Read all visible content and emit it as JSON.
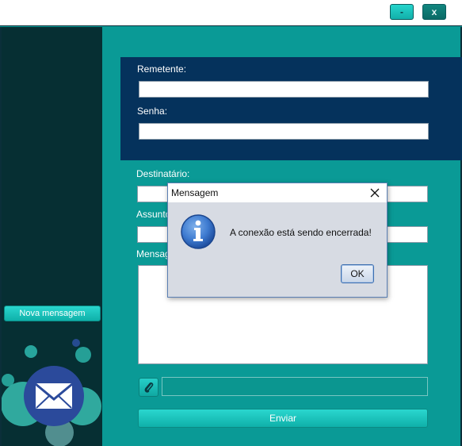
{
  "window": {
    "minimize_label": "-",
    "close_label": "x"
  },
  "sidebar": {
    "new_message_label": "Nova mensagem",
    "logo_icon": "envelope-icon"
  },
  "form": {
    "sender_label": "Remetente:",
    "sender_value": "",
    "password_label": "Senha:",
    "password_value": "",
    "recipient_label": "Destinatário:",
    "recipient_value": "",
    "subject_label": "Assunto:",
    "subject_value": "",
    "message_label": "Mensagem:",
    "message_value": "",
    "attachment_icon": "paperclip-icon",
    "attachment_value": "",
    "send_label": "Enviar"
  },
  "dialog": {
    "title": "Mensagem",
    "close_label": "close",
    "icon": "info-icon",
    "message": "A conexão está sendo encerrada!",
    "ok_label": "OK"
  },
  "colors": {
    "main_bg": "#0a9a96",
    "sidebar_bg": "#062f33",
    "auth_panel_bg": "#05325c",
    "accent_button": "#1fc2bb",
    "dialog_bg": "#d7dbe3"
  }
}
